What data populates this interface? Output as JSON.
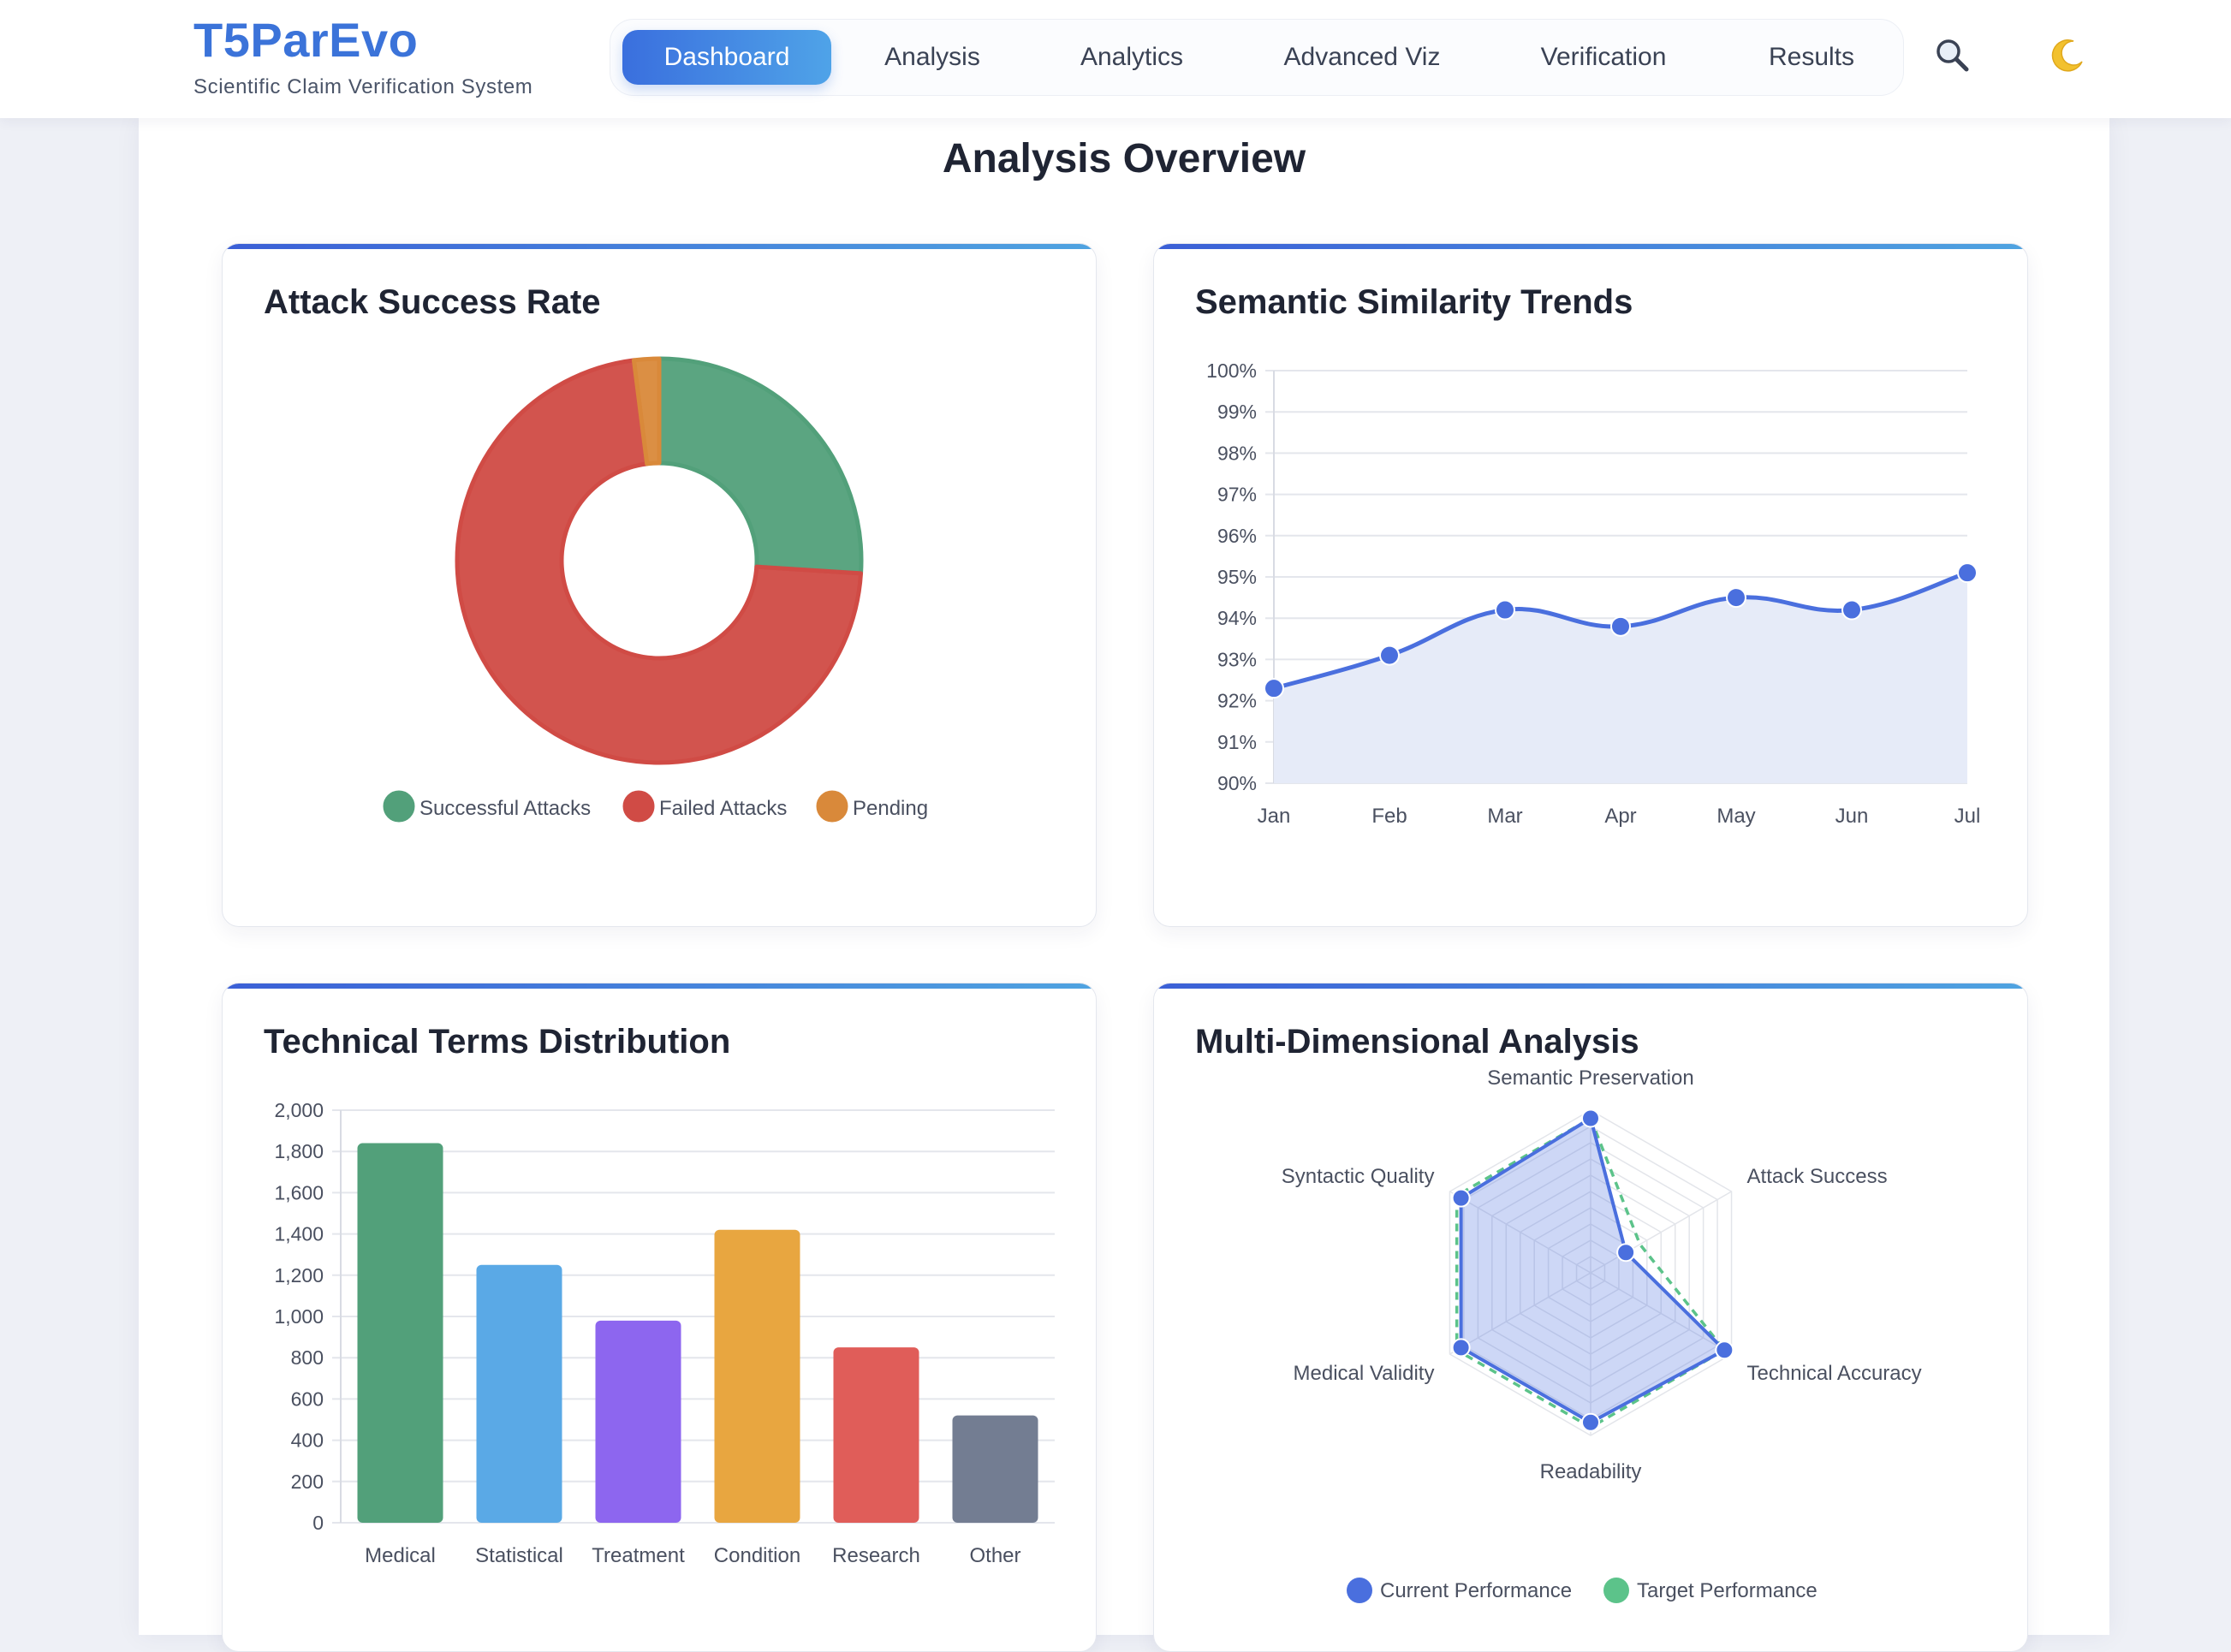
{
  "header": {
    "brand_title": "T5ParEvo",
    "brand_subtitle": "Scientific Claim Verification System",
    "nav": [
      {
        "label": "Dashboard",
        "active": true
      },
      {
        "label": "Analysis"
      },
      {
        "label": "Analytics"
      },
      {
        "label": "Advanced Viz"
      },
      {
        "label": "Verification"
      },
      {
        "label": "Results"
      }
    ],
    "search_icon": "search-icon",
    "theme_icon": "moon-icon"
  },
  "main": {
    "title": "Analysis Overview"
  },
  "panels": {
    "attack": {
      "title": "Attack Success Rate"
    },
    "trend": {
      "title": "Semantic Similarity Trends"
    },
    "terms": {
      "title": "Technical Terms Distribution"
    },
    "radar": {
      "title": "Multi-Dimensional Analysis"
    }
  },
  "colors": {
    "accent": "#3b73d9",
    "success": "#52a07a",
    "failed": "#d04b45",
    "pending": "#d9893a",
    "line": "#4a6fde",
    "target": "#5cc38a"
  },
  "chart_data": [
    {
      "type": "pie",
      "title": "Attack Success Rate",
      "categories": [
        "Successful Attacks",
        "Failed Attacks",
        "Pending"
      ],
      "values": [
        26,
        72,
        2
      ],
      "colors": [
        "#52a07a",
        "#d04b45",
        "#d9893a"
      ],
      "legend": "bottom"
    },
    {
      "type": "area",
      "title": "Semantic Similarity Trends",
      "categories": [
        "Jan",
        "Feb",
        "Mar",
        "Apr",
        "May",
        "Jun",
        "Jul"
      ],
      "values": [
        92.3,
        93.1,
        94.2,
        93.8,
        94.5,
        94.2,
        95.1
      ],
      "ylim": [
        90,
        100
      ],
      "yticks": [
        "90%",
        "91%",
        "92%",
        "93%",
        "94%",
        "95%",
        "96%",
        "97%",
        "98%",
        "99%",
        "100%"
      ],
      "grid": true
    },
    {
      "type": "bar",
      "title": "Technical Terms Distribution",
      "categories": [
        "Medical",
        "Statistical",
        "Treatment",
        "Condition",
        "Research",
        "Other"
      ],
      "values": [
        1840,
        1250,
        980,
        1420,
        850,
        520
      ],
      "colors": [
        "#52a07a",
        "#5aa9e6",
        "#8d66ef",
        "#e8a640",
        "#e05d59",
        "#737d92"
      ],
      "ylim": [
        0,
        2000
      ],
      "yticks": [
        "0",
        "200",
        "400",
        "600",
        "800",
        "1,000",
        "1,200",
        "1,400",
        "1,600",
        "1,800",
        "2,000"
      ],
      "grid": true
    },
    {
      "type": "radar",
      "title": "Multi-Dimensional Analysis",
      "categories": [
        "Semantic Preservation",
        "Attack Success",
        "Technical Accuracy",
        "Readability",
        "Medical Validity",
        "Syntactic Quality"
      ],
      "series": [
        {
          "name": "Current Performance",
          "values": [
            0.95,
            0.25,
            0.95,
            0.92,
            0.92,
            0.92
          ],
          "color": "#4a6fde"
        },
        {
          "name": "Target Performance",
          "values": [
            0.95,
            0.35,
            0.95,
            0.95,
            0.95,
            0.95
          ],
          "color": "#5cc38a"
        }
      ],
      "range": [
        0,
        1
      ],
      "legend": "bottom"
    }
  ]
}
